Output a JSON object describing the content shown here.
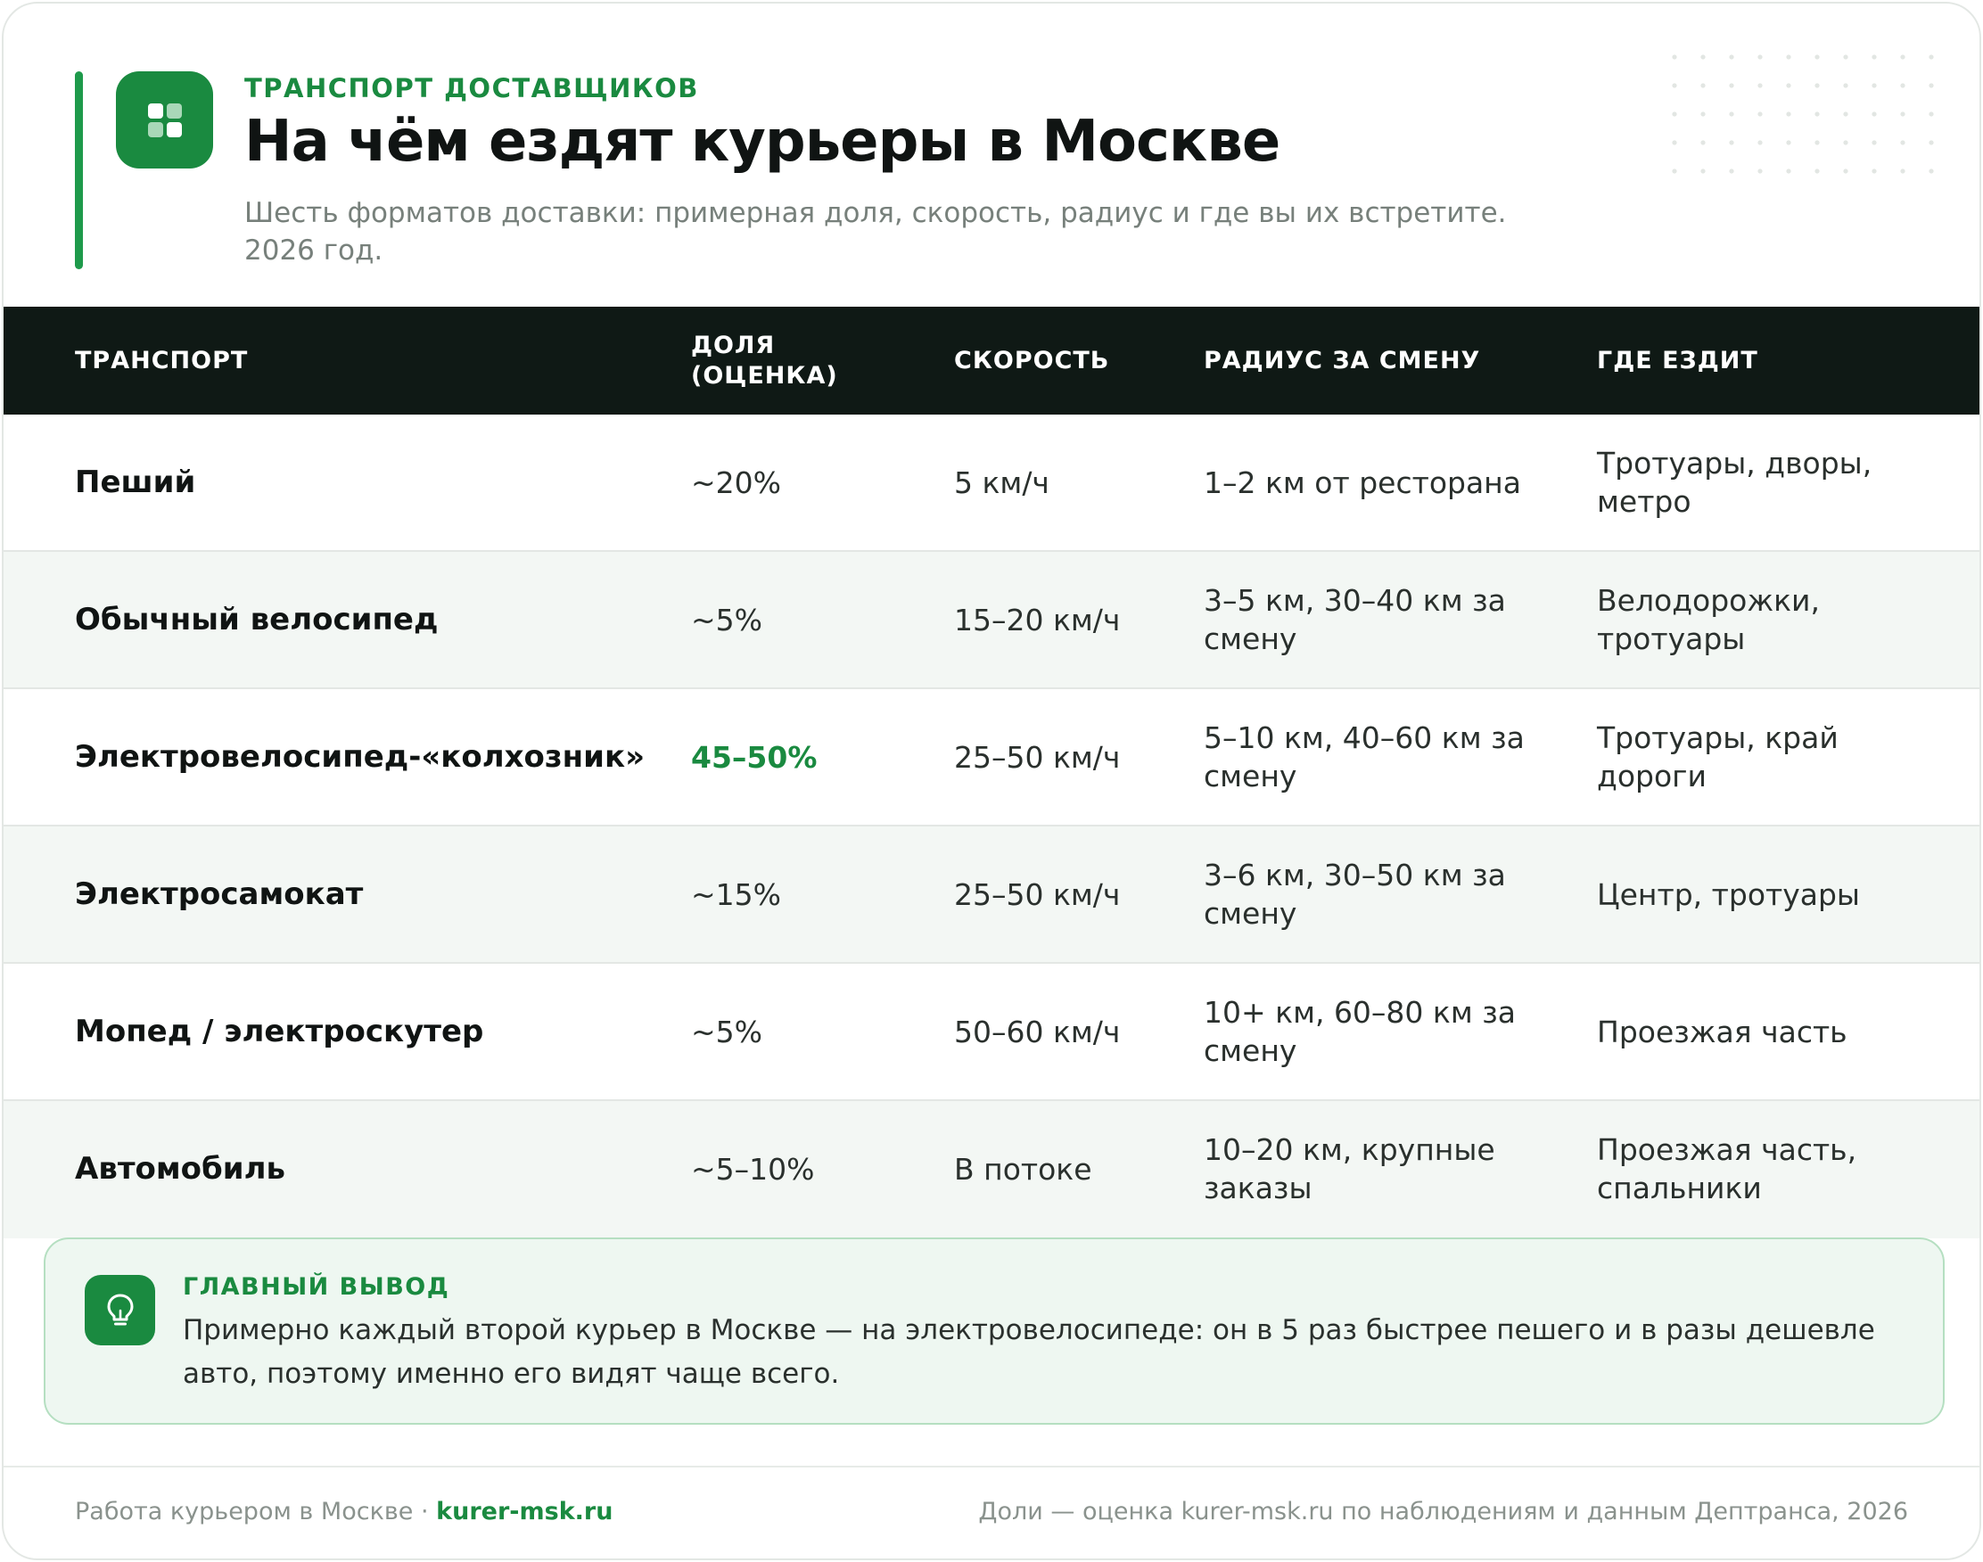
{
  "header": {
    "eyebrow": "ТРАНСПОРТ ДОСТАВЩИКОВ",
    "title": "На чём ездят курьеры в Москве",
    "subtitle": "Шесть форматов доставки: примерная доля, скорость, радиус и где вы их встретите. 2026 год."
  },
  "colors": {
    "accent": "#1a8a40",
    "header_bg": "#0f1915",
    "alt_row_bg": "#f3f7f4",
    "conclusion_bg": "#eef7f1"
  },
  "icons": {
    "logo": "grid-icon",
    "conclusion": "lightbulb-icon"
  },
  "table": {
    "columns": [
      "ТРАНСПОРТ",
      "ДОЛЯ (ОЦЕНКА)",
      "СКОРОСТЬ",
      "РАДИУС ЗА СМЕНУ",
      "ГДЕ ЕЗДИТ"
    ],
    "rows": [
      {
        "transport": "Пеший",
        "share": "~20%",
        "speed": "5 км/ч",
        "radius": "1–2 км от ресторана",
        "where": "Тротуары, дворы, метро"
      },
      {
        "transport": "Обычный велосипед",
        "share": "~5%",
        "speed": "15–20 км/ч",
        "radius": "3–5 км, 30–40 км за смену",
        "where": "Велодорожки, тротуары"
      },
      {
        "transport": "Электровелосипед-«колхозник»",
        "share": "45–50%",
        "speed": "25–50 км/ч",
        "radius": "5–10 км, 40–60 км за смену",
        "where": "Тротуары, край дороги"
      },
      {
        "transport": "Электросамокат",
        "share": "~15%",
        "speed": "25–50 км/ч",
        "radius": "3–6 км, 30–50 км за смену",
        "where": "Центр, тротуары"
      },
      {
        "transport": "Мопед / электроскутер",
        "share": "~5%",
        "speed": "50–60 км/ч",
        "radius": "10+ км, 60–80 км за смену",
        "where": "Проезжая часть"
      },
      {
        "transport": "Автомобиль",
        "share": "~5–10%",
        "speed": "В потоке",
        "radius": "10–20 км, крупные заказы",
        "where": "Проезжая часть, спальники"
      }
    ]
  },
  "conclusion": {
    "label": "ГЛАВНЫЙ ВЫВОД",
    "text": "Примерно каждый второй курьер в Москве — на электровелосипеде: он в 5 раз быстрее пешего и в разы дешевле авто, поэтому именно его видят чаще всего."
  },
  "footer": {
    "left_text": "Работа курьером в Москве · ",
    "brand": "kurer-msk.ru",
    "right_text": "Доли — оценка kurer-msk.ru по наблюдениям и данным Дептранса, 2026"
  }
}
